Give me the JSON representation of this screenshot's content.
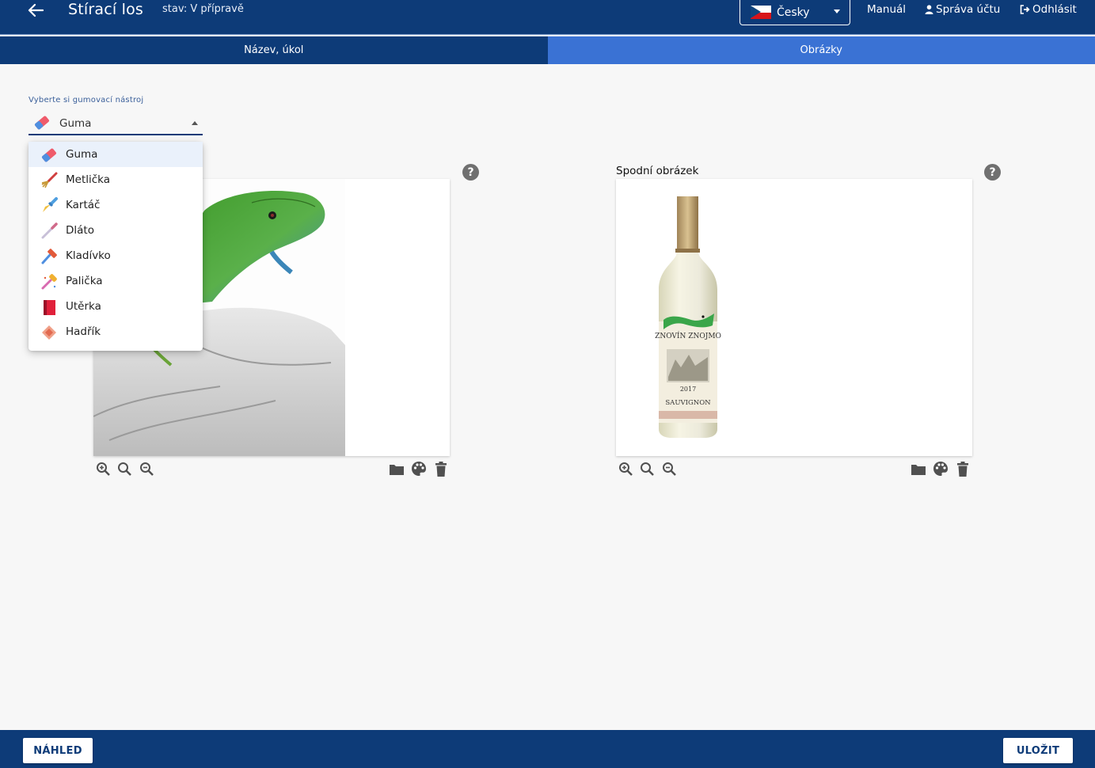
{
  "header": {
    "title": "Stírací los",
    "status": "stav: V přípravě",
    "language": "Česky",
    "links": {
      "manual": "Manuál",
      "account": "Správa účtu",
      "logout": "Odhlásit"
    }
  },
  "tabs": [
    {
      "label": "Název, úkol",
      "active": false
    },
    {
      "label": "Obrázky",
      "active": true
    }
  ],
  "tool_picker": {
    "label": "Vyberte si gumovací nástroj",
    "selected": "Guma",
    "options": [
      {
        "label": "Guma",
        "icon": "eraser-icon",
        "selected": true
      },
      {
        "label": "Metlička",
        "icon": "whisk-icon"
      },
      {
        "label": "Kartáč",
        "icon": "brush-icon"
      },
      {
        "label": "Dláto",
        "icon": "chisel-icon"
      },
      {
        "label": "Kladívko",
        "icon": "hammer-icon"
      },
      {
        "label": "Palička",
        "icon": "mallet-icon"
      },
      {
        "label": "Utěrka",
        "icon": "towel-icon"
      },
      {
        "label": "Hadřík",
        "icon": "rag-icon"
      }
    ]
  },
  "panels": {
    "top_image": {
      "description": "lizard-drawing-image"
    },
    "bottom_image": {
      "title": "Spodní obrázek",
      "description": "wine-bottle-image"
    }
  },
  "footer": {
    "preview_label": "NÁHLED",
    "save_label": "ULOŽIT"
  },
  "colors": {
    "header_bg": "#0d3b78",
    "tab_active": "#3a72d4",
    "page_bg": "#f7f7f7"
  }
}
